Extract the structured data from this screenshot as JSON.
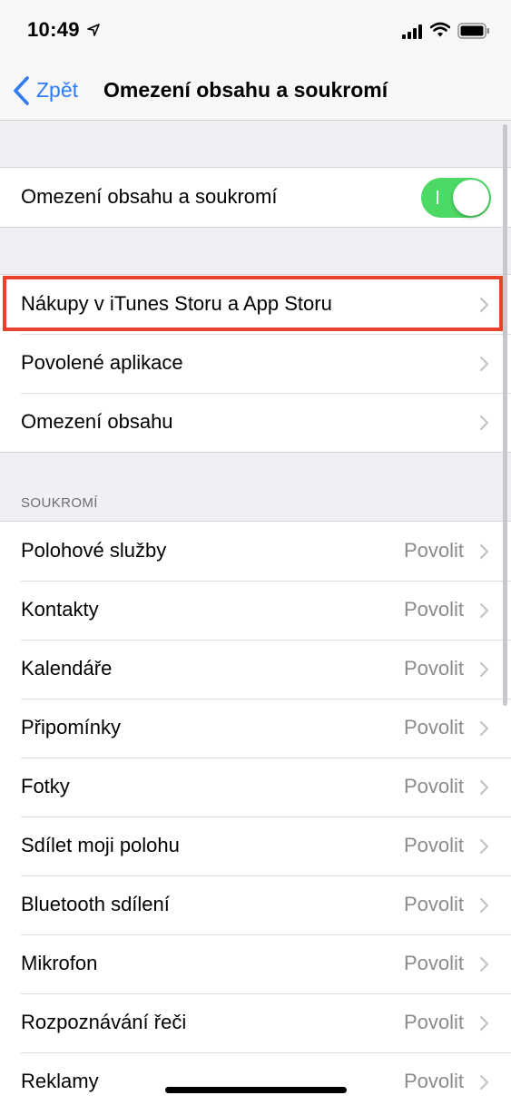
{
  "status_bar": {
    "time": "10:49",
    "icons": [
      "location-arrow-icon",
      "cellular-signal-icon",
      "wifi-icon",
      "battery-icon"
    ]
  },
  "nav": {
    "back_label": "Zpět",
    "title": "Omezení obsahu a soukromí"
  },
  "toggle_row": {
    "label": "Omezení obsahu a soukromí",
    "enabled": true,
    "color": "#4cd964"
  },
  "content_rows": [
    {
      "label": "Nákupy v iTunes Storu a App Storu",
      "highlighted": true
    },
    {
      "label": "Povolené aplikace"
    },
    {
      "label": "Omezení obsahu"
    }
  ],
  "privacy": {
    "header": "SOUKROMÍ",
    "rows": [
      {
        "label": "Polohové služby",
        "value": "Povolit"
      },
      {
        "label": "Kontakty",
        "value": "Povolit"
      },
      {
        "label": "Kalendáře",
        "value": "Povolit"
      },
      {
        "label": "Připomínky",
        "value": "Povolit"
      },
      {
        "label": "Fotky",
        "value": "Povolit"
      },
      {
        "label": "Sdílet moji polohu",
        "value": "Povolit"
      },
      {
        "label": "Bluetooth sdílení",
        "value": "Povolit"
      },
      {
        "label": "Mikrofon",
        "value": "Povolit"
      },
      {
        "label": "Rozpoznávání řeči",
        "value": "Povolit"
      },
      {
        "label": "Reklamy",
        "value": "Povolit"
      }
    ]
  },
  "colors": {
    "accent": "#2f7cf6",
    "highlight_border": "#e8432b",
    "background": "#efeff4"
  }
}
